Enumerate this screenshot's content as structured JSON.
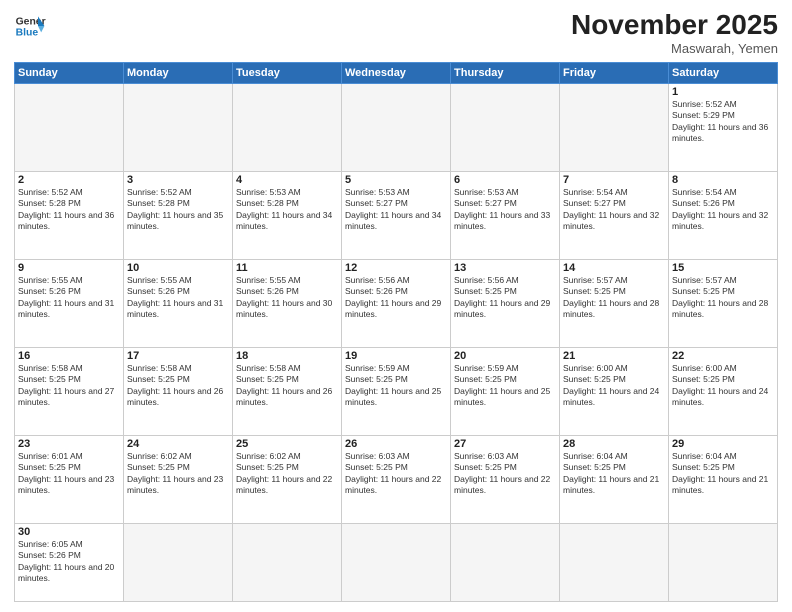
{
  "header": {
    "logo_line1": "General",
    "logo_line2": "Blue",
    "month_title": "November 2025",
    "location": "Maswarah, Yemen"
  },
  "weekdays": [
    "Sunday",
    "Monday",
    "Tuesday",
    "Wednesday",
    "Thursday",
    "Friday",
    "Saturday"
  ],
  "weeks": [
    [
      {
        "day": null
      },
      {
        "day": null
      },
      {
        "day": null
      },
      {
        "day": null
      },
      {
        "day": null
      },
      {
        "day": null
      },
      {
        "day": 1,
        "sunrise": "5:52 AM",
        "sunset": "5:29 PM",
        "daylight": "11 hours and 36 minutes."
      }
    ],
    [
      {
        "day": 2,
        "sunrise": "5:52 AM",
        "sunset": "5:28 PM",
        "daylight": "11 hours and 36 minutes."
      },
      {
        "day": 3,
        "sunrise": "5:52 AM",
        "sunset": "5:28 PM",
        "daylight": "11 hours and 35 minutes."
      },
      {
        "day": 4,
        "sunrise": "5:53 AM",
        "sunset": "5:28 PM",
        "daylight": "11 hours and 34 minutes."
      },
      {
        "day": 5,
        "sunrise": "5:53 AM",
        "sunset": "5:27 PM",
        "daylight": "11 hours and 34 minutes."
      },
      {
        "day": 6,
        "sunrise": "5:53 AM",
        "sunset": "5:27 PM",
        "daylight": "11 hours and 33 minutes."
      },
      {
        "day": 7,
        "sunrise": "5:54 AM",
        "sunset": "5:27 PM",
        "daylight": "11 hours and 32 minutes."
      },
      {
        "day": 8,
        "sunrise": "5:54 AM",
        "sunset": "5:26 PM",
        "daylight": "11 hours and 32 minutes."
      }
    ],
    [
      {
        "day": 9,
        "sunrise": "5:55 AM",
        "sunset": "5:26 PM",
        "daylight": "11 hours and 31 minutes."
      },
      {
        "day": 10,
        "sunrise": "5:55 AM",
        "sunset": "5:26 PM",
        "daylight": "11 hours and 31 minutes."
      },
      {
        "day": 11,
        "sunrise": "5:55 AM",
        "sunset": "5:26 PM",
        "daylight": "11 hours and 30 minutes."
      },
      {
        "day": 12,
        "sunrise": "5:56 AM",
        "sunset": "5:26 PM",
        "daylight": "11 hours and 29 minutes."
      },
      {
        "day": 13,
        "sunrise": "5:56 AM",
        "sunset": "5:25 PM",
        "daylight": "11 hours and 29 minutes."
      },
      {
        "day": 14,
        "sunrise": "5:57 AM",
        "sunset": "5:25 PM",
        "daylight": "11 hours and 28 minutes."
      },
      {
        "day": 15,
        "sunrise": "5:57 AM",
        "sunset": "5:25 PM",
        "daylight": "11 hours and 28 minutes."
      }
    ],
    [
      {
        "day": 16,
        "sunrise": "5:58 AM",
        "sunset": "5:25 PM",
        "daylight": "11 hours and 27 minutes."
      },
      {
        "day": 17,
        "sunrise": "5:58 AM",
        "sunset": "5:25 PM",
        "daylight": "11 hours and 26 minutes."
      },
      {
        "day": 18,
        "sunrise": "5:58 AM",
        "sunset": "5:25 PM",
        "daylight": "11 hours and 26 minutes."
      },
      {
        "day": 19,
        "sunrise": "5:59 AM",
        "sunset": "5:25 PM",
        "daylight": "11 hours and 25 minutes."
      },
      {
        "day": 20,
        "sunrise": "5:59 AM",
        "sunset": "5:25 PM",
        "daylight": "11 hours and 25 minutes."
      },
      {
        "day": 21,
        "sunrise": "6:00 AM",
        "sunset": "5:25 PM",
        "daylight": "11 hours and 24 minutes."
      },
      {
        "day": 22,
        "sunrise": "6:00 AM",
        "sunset": "5:25 PM",
        "daylight": "11 hours and 24 minutes."
      }
    ],
    [
      {
        "day": 23,
        "sunrise": "6:01 AM",
        "sunset": "5:25 PM",
        "daylight": "11 hours and 23 minutes."
      },
      {
        "day": 24,
        "sunrise": "6:02 AM",
        "sunset": "5:25 PM",
        "daylight": "11 hours and 23 minutes."
      },
      {
        "day": 25,
        "sunrise": "6:02 AM",
        "sunset": "5:25 PM",
        "daylight": "11 hours and 22 minutes."
      },
      {
        "day": 26,
        "sunrise": "6:03 AM",
        "sunset": "5:25 PM",
        "daylight": "11 hours and 22 minutes."
      },
      {
        "day": 27,
        "sunrise": "6:03 AM",
        "sunset": "5:25 PM",
        "daylight": "11 hours and 22 minutes."
      },
      {
        "day": 28,
        "sunrise": "6:04 AM",
        "sunset": "5:25 PM",
        "daylight": "11 hours and 21 minutes."
      },
      {
        "day": 29,
        "sunrise": "6:04 AM",
        "sunset": "5:25 PM",
        "daylight": "11 hours and 21 minutes."
      }
    ],
    [
      {
        "day": 30,
        "sunrise": "6:05 AM",
        "sunset": "5:26 PM",
        "daylight": "11 hours and 20 minutes."
      },
      {
        "day": null
      },
      {
        "day": null
      },
      {
        "day": null
      },
      {
        "day": null
      },
      {
        "day": null
      },
      {
        "day": null
      }
    ]
  ]
}
